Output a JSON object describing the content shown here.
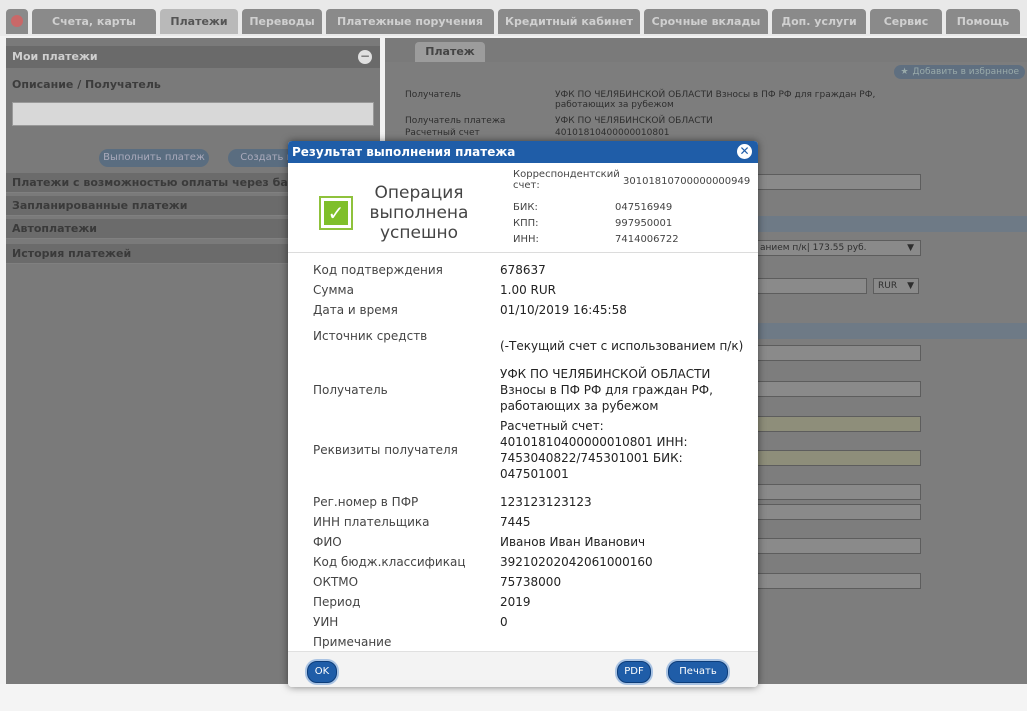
{
  "nav": {
    "tabs": [
      {
        "label": "Счета, карты"
      },
      {
        "label": "Платежи"
      },
      {
        "label": "Переводы"
      },
      {
        "label": "Платежные поручения"
      },
      {
        "label": "Кредитный кабинет"
      },
      {
        "label": "Срочные вклады"
      },
      {
        "label": "Доп. услуги"
      },
      {
        "label": "Сервис"
      },
      {
        "label": "Помощь"
      }
    ]
  },
  "left": {
    "title": "Мои платежи",
    "desc_label": "Описание / Получатель",
    "btn_execute": "Выполнить платеж",
    "btn_create": "Создать ш",
    "sections": [
      "Платежи с возможностью оплаты через банк",
      "Запланированные платежи",
      "Автоплатежи",
      "История платежей"
    ]
  },
  "right": {
    "tab": "Платеж",
    "fav": "Добавить в избранное",
    "recipient_label": "Получатель",
    "recipient_value": "УФК ПО ЧЕЛЯБИНСКОЙ ОБЛАСТИ Взносы в ПФ РФ для граждан РФ, работающих за рубежом",
    "payer_label": "Получатель платежа",
    "payer_value": "УФК ПО ЧЕЛЯБИНСКОЙ ОБЛАСТИ",
    "account_label": "Расчетный счет",
    "account_value": "40101810400000010801",
    "source_select": "анием п/к| 173.55 руб.",
    "currency": "RUR"
  },
  "modal": {
    "title": "Результат выполнения платежа",
    "status_text": "Операция выполнена успешно",
    "corr_label": "Корреспондентский счет:",
    "corr_value": "30101810700000000949",
    "bik_label": "БИК:",
    "bik_value": "047516949",
    "kpp_label": "КПП:",
    "kpp_value": "997950001",
    "inn_label": "ИНН:",
    "inn_value": "7414006722",
    "rows": [
      {
        "label": "Код подтверждения",
        "value": "678637"
      },
      {
        "label": "Сумма",
        "value": "1.00 RUR"
      },
      {
        "label": "Дата и время",
        "value": "01/10/2019 16:45:58"
      },
      {
        "label": "Источник средств",
        "value": "(-Текущий счет с использованием п/к)"
      },
      {
        "label": "Получатель",
        "value": "УФК ПО ЧЕЛЯБИНСКОЙ ОБЛАСТИ Взносы в ПФ РФ для граждан РФ, работающих за рубежом"
      },
      {
        "label": "Реквизиты получателя",
        "value": "Расчетный счет: 40101810400000010801 ИНН: 7453040822/745301001 БИК: 047501001"
      },
      {
        "label": "Рег.номер в ПФР",
        "value": "123123123123"
      },
      {
        "label": "ИНН плательщика",
        "value": "7445"
      },
      {
        "label": "ФИО",
        "value": "Иванов Иван Иванович"
      },
      {
        "label": "Код бюдж.классификац",
        "value": "39210202042061000160"
      },
      {
        "label": "ОКТМО",
        "value": "75738000"
      },
      {
        "label": "Период",
        "value": "2019"
      },
      {
        "label": "УИН",
        "value": "0"
      },
      {
        "label": "Примечание",
        "value": ""
      }
    ],
    "btn_ok": "OK",
    "btn_pdf": "PDF",
    "btn_print": "Печать"
  }
}
